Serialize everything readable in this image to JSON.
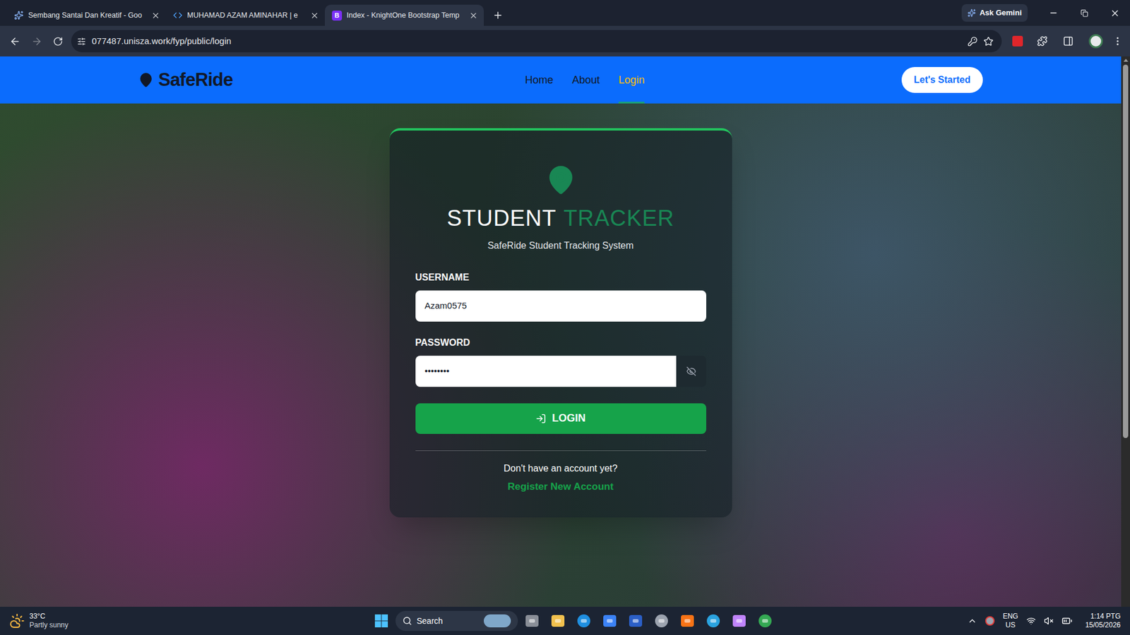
{
  "browser": {
    "tabs": [
      {
        "label": "Sembang Santai Dan Kreatif - Goo",
        "selected": false,
        "kind": "gemini"
      },
      {
        "label": "MUHAMAD AZAM AMINAHAR | e",
        "selected": false,
        "kind": "code"
      },
      {
        "label": "Index - KnightOne Bootstrap Temp",
        "selected": true,
        "kind": "bootstrap"
      }
    ],
    "bootstrap_badge": "B",
    "ask_gemini": "Ask Gemini",
    "url": "077487.unisza.work/fyp/public/login"
  },
  "site": {
    "logo": "SafeRide",
    "nav": [
      {
        "label": "Home",
        "selected": false
      },
      {
        "label": "About",
        "selected": false
      },
      {
        "label": "Login",
        "selected": true
      }
    ],
    "cta": "Let's Started"
  },
  "login": {
    "title_main": "STUDENT",
    "title_accent": "TRACKER",
    "subtitle": "SafeRide Student Tracking System",
    "fields": [
      {
        "label": "USERNAME",
        "value": "Azam0575",
        "kind": "text"
      },
      {
        "label": "PASSWORD",
        "value": "••••••••",
        "kind": "password"
      }
    ],
    "button": "LOGIN",
    "prompt": "Don't have an account yet?",
    "link": "Register New Account"
  },
  "taskbar": {
    "weather": {
      "temp": "33°C",
      "condition": "Partly sunny"
    },
    "search": "Search",
    "language": [
      "ENG",
      "US"
    ],
    "time": "1:14 PTG",
    "date": "15/05/2026"
  }
}
